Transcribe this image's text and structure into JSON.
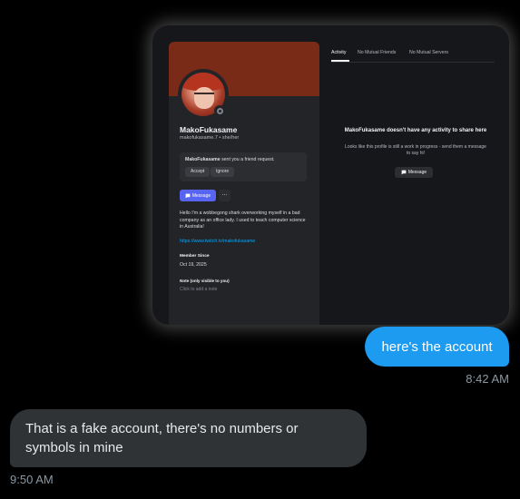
{
  "profile": {
    "display_name": "MakoFukasame",
    "user_tag": "makofukasame.7 • she/her",
    "friend_request": {
      "name": "MakoFukasame",
      "text": " sent you a friend request.",
      "accept": "Accept",
      "ignore": "Ignore"
    },
    "message_button": "Message",
    "more_button": "...",
    "bio": "Hello I'm a wobbegong shark overworking myself in a bad company as an office lady. I used to teach computer science in Australia!",
    "link": "https://www.twitch.tv/makofukasame",
    "member_since_label": "Member Since",
    "member_since": "Oct 19, 2025",
    "note_label": "Note (only visible to you)",
    "note_placeholder": "Click to add a note"
  },
  "tabs": [
    "Activity",
    "No Mutual Friends",
    "No Mutual Servers"
  ],
  "activity": {
    "title": "MakoFukasame doesn't have any activity to share here",
    "subtitle": "Looks like this profile is still a work in progress - send them a message to say hi!",
    "button": "Message"
  },
  "chat": {
    "outgoing": {
      "text": "here's the account",
      "time": "8:42 AM"
    },
    "incoming": {
      "text": "That is a fake account, there's no numbers or symbols in mine",
      "time": "9:50 AM"
    }
  },
  "colors": {
    "banner": "#7a2b17",
    "blurple": "#5865f2",
    "bubble_out": "#1d9bf0",
    "bubble_in": "#2f3336"
  },
  "icons": {
    "status": "offline-status-icon",
    "message": "chat-bubble-icon"
  }
}
